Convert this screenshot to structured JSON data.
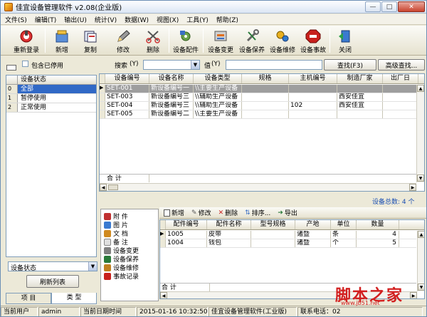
{
  "title": "佳宜设备管理软件 v2.08(企业版)",
  "window_buttons": {
    "min": "—",
    "max": "□",
    "close": "✕"
  },
  "menu": [
    "文件(S)",
    "编辑(T)",
    "输出(U)",
    "统计(V)",
    "数据(W)",
    "视图(X)",
    "工具(Y)",
    "帮助(Z)"
  ],
  "toolbar": {
    "relogin": "重新登录",
    "add": "新增",
    "copy": "复制",
    "edit": "修改",
    "delete": "删除",
    "config": "设备配件",
    "change": "设备变更",
    "maintain": "设备保养",
    "repair": "设备维修",
    "accident": "设备事故",
    "close": "关闭"
  },
  "search": {
    "include_disabled": "包含已停用",
    "search_label": "搜索",
    "search_hotkey": "(Y)",
    "value_label": "值",
    "value_hotkey": "(Y)",
    "find_button": "查找(F3)",
    "advanced_button": "高级查找..."
  },
  "status_list": {
    "header": "设备状态",
    "items": [
      {
        "num": "0",
        "label": "全部"
      },
      {
        "num": "1",
        "label": "暂停使用"
      },
      {
        "num": "2",
        "label": "正常使用"
      }
    ]
  },
  "filter_combo": "设备状态",
  "refresh_button": "刷新列表",
  "left_tabs": [
    "项 目",
    "类 型"
  ],
  "main_grid": {
    "headers": [
      "设备编号",
      "设备名称",
      "设备类型",
      "规格",
      "主机编号",
      "制造厂家",
      "出厂日"
    ],
    "rows": [
      [
        "SET-001",
        "新设备编号一",
        "\\\\主要生产设备",
        "",
        "",
        "",
        ""
      ],
      [
        "SET-003",
        "新设备编号三",
        "\\\\辅助生产设备",
        "",
        "",
        "西安佳宜",
        ""
      ],
      [
        "SET-004",
        "新设备编号三",
        "\\\\辅助生产设备",
        "",
        "102",
        "西安佳宜",
        ""
      ],
      [
        "SET-005",
        "新设备编号二",
        "\\\\主要生产设备",
        "",
        "",
        "",
        ""
      ]
    ],
    "sum_label": "合 计"
  },
  "device_count": "设备总数: 4 个",
  "side_menu": [
    "附 件",
    "图 片",
    "文 档",
    "备 注",
    "设备变更",
    "设备保养",
    "设备维修",
    "事故记录"
  ],
  "sub_toolbar": {
    "add": "新增",
    "edit": "修改",
    "delete": "删除",
    "sort": "排序...",
    "export": "导出"
  },
  "parts_grid": {
    "headers": [
      "配件编号",
      "配件名称",
      "型号规格",
      "产地",
      "单位",
      "数量"
    ],
    "rows": [
      [
        "1005",
        "皮带",
        "",
        "诸暨",
        "条",
        "4"
      ],
      [
        "1004",
        "钱包",
        "",
        "诸暨",
        "个",
        "5"
      ]
    ],
    "sum_label": "合 计"
  },
  "status_bar": {
    "user_label": "当前用户",
    "user": "admin",
    "date_label": "当前日期时间",
    "datetime": "2015-01-16 10:32:50",
    "app": "佳宜设备管理软件(工业版)",
    "contact": "联系电话：02"
  },
  "watermark": {
    "big": "脚本之家",
    "url": "www.jb51.net"
  },
  "colors": {
    "selection": "#3169c6",
    "accent": "#1a4fb2"
  }
}
